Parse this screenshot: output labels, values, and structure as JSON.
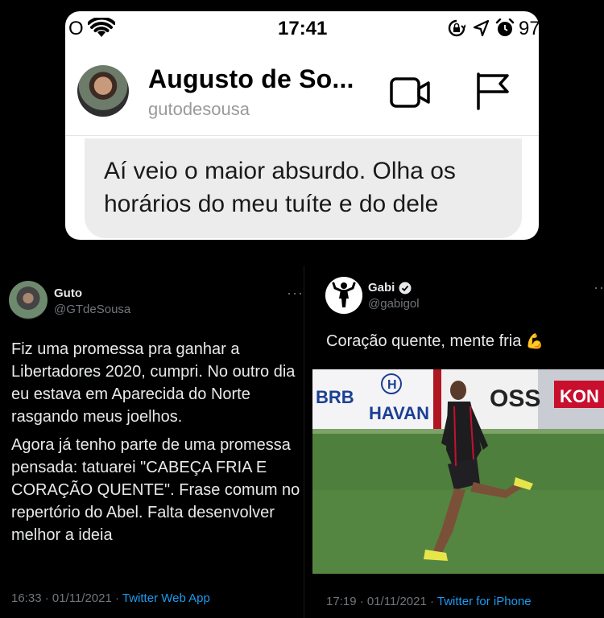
{
  "dm": {
    "status_bar": {
      "carrier": "O",
      "time": "17:41",
      "battery": "97"
    },
    "header": {
      "name": "Augusto de So...",
      "handle": "gutodesousa"
    },
    "message": "Aí veio o maior absurdo. Olha os horários do meu tuíte e do dele",
    "icons": [
      "wifi-icon",
      "lock-rotation-icon",
      "location-icon",
      "alarm-icon",
      "video-call-icon",
      "flag-icon"
    ]
  },
  "tweet_left": {
    "name": "Guto",
    "handle": "@GTdeSousa",
    "more": "···",
    "paragraph1": "Fiz uma promessa pra ganhar a Libertadores 2020, cumpri. No outro dia eu estava em Aparecida do Norte rasgando meus joelhos.",
    "paragraph2": "Agora já tenho parte de uma promessa pensada: tatuarei \"CABEÇA FRIA E CORAÇÃO QUENTE\". Frase comum no repertório do Abel. Falta desenvolver melhor a ideia",
    "time": "16:33 · 01/11/2021 · ",
    "app": "Twitter Web App"
  },
  "tweet_right": {
    "name": "Gabi",
    "handle": "@gabigol",
    "more": "···",
    "text": "Coração quente, mente fria ",
    "emoji": "💪",
    "time": "17:19 · 01/11/2021 · ",
    "app": "Twitter for iPhone",
    "photo_signage": {
      "brb": "BRB",
      "havan_logo": "H",
      "havan": "HAVAN",
      "banner1": "OSS",
      "banner2": "KON"
    }
  },
  "colors": {
    "background": "#000000",
    "link": "#1d9bf0",
    "muted": "#71767b",
    "bubble": "#ececec"
  }
}
